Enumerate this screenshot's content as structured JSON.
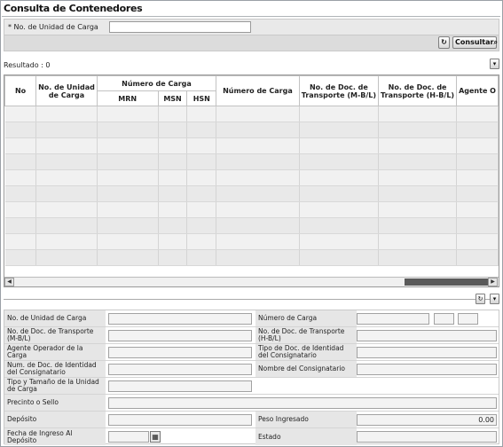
{
  "title": "Consulta de Contenedores",
  "search": {
    "label": "* No. de Unidad de Carga",
    "value": "",
    "buttons": {
      "consultar_label": "Consultar"
    }
  },
  "result": {
    "label": "Resultado : 0"
  },
  "grid": {
    "headers": {
      "no": "No",
      "unidad_l1": "No. de Unidad",
      "unidad_l2": "de Carga",
      "numero_carga_group": "Número de Carga",
      "mrn": "MRN",
      "msn": "MSN",
      "hsn": "HSN",
      "numero_carga": "Número de Carga",
      "mbl_l1": "No. de Doc. de",
      "mbl_l2": "Transporte (M-B/L)",
      "hbl_l1": "No. de Doc. de",
      "hbl_l2": "Transporte (H-B/L)",
      "agente": "Agente O"
    },
    "rows": []
  },
  "detail": {
    "unidad_carga": "No. de Unidad de Carga",
    "numero_carga": "Número de Carga",
    "doc_mbl": "No. de Doc. de Transporte (M-B/L)",
    "doc_hbl": "No. de Doc. de Transporte (H-B/L)",
    "agente_operador": "Agente Operador de la Carga",
    "tipo_doc_consignatario": "Tipo de Doc. de Identidad del Consignatario",
    "num_doc_consignatario": "Num. de Doc. de Identidad del Consignatario",
    "nombre_consignatario": "Nombre del Consignatario",
    "tipo_tamano": "Tipo y Tamaño de la Unidad de Carga",
    "precinto": "Precinto o Sello",
    "deposito": "Depósito",
    "peso_ingresado": "Peso Ingresado",
    "peso_value": "0.00",
    "fecha_ingreso": "Fecha de Ingreso Al Depósito",
    "estado": "Estado"
  }
}
